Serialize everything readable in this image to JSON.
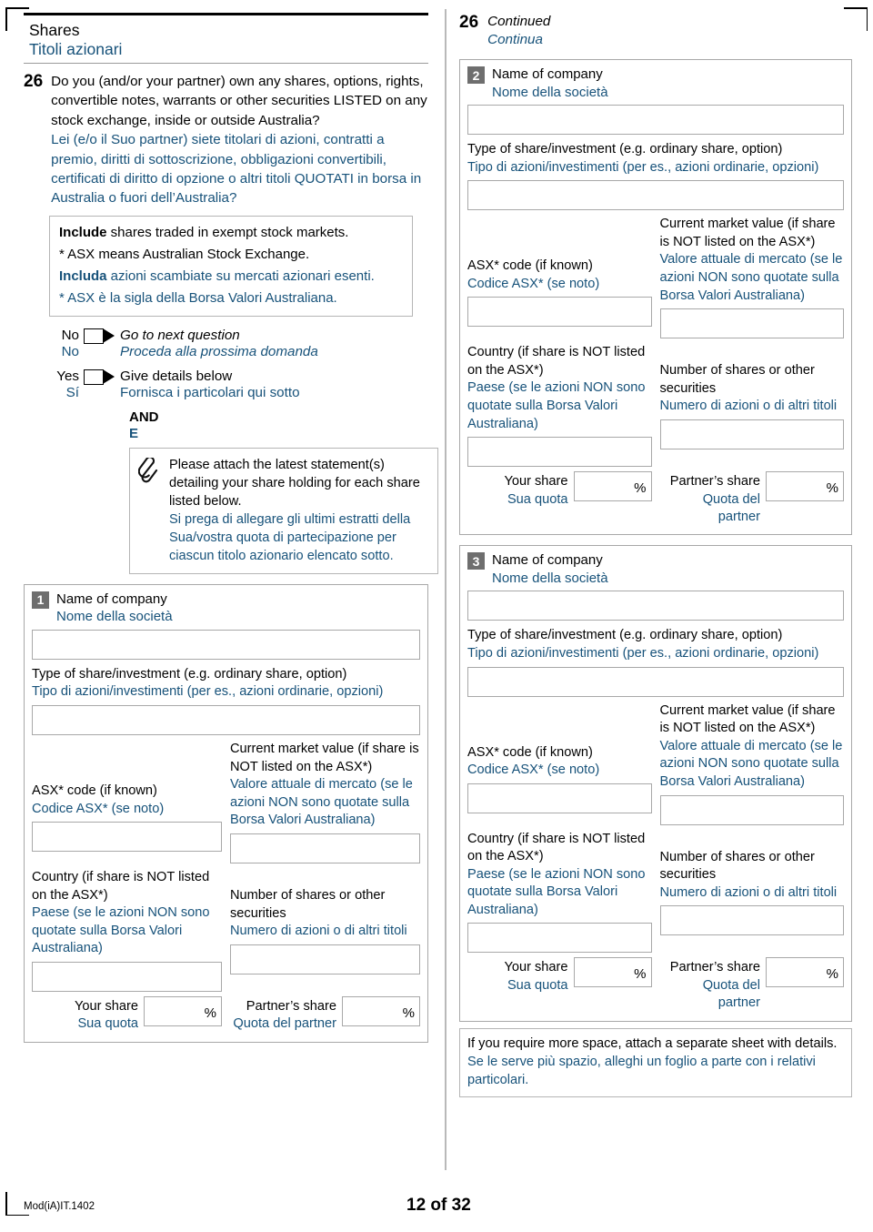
{
  "section": {
    "title_en": "Shares",
    "title_it": "Titoli azionari"
  },
  "question": {
    "number": "26",
    "text_en": "Do you (and/or your partner) own any shares, options, rights, convertible notes, warrants or other securities LISTED on any stock exchange, inside or outside Australia?",
    "text_it": "Lei (e/o il Suo partner) siete titolari di azioni, contratti a premio, diritti di sottoscrizione, obbligazioni convertibili, certificati di diritto di opzione o altri titoli QUOTATI in borsa in Australia o fuori dell’Australia?"
  },
  "note": {
    "line1_bold": "Include",
    "line1_rest": " shares traded in exempt stock markets.",
    "line2": "* ASX means Australian Stock Exchange.",
    "line3_bold": "Includa",
    "line3_rest": " azioni scambiate su mercati azionari esenti.",
    "line4": "* ASX è la sigla della Borsa Valori Australiana."
  },
  "answers": {
    "no": {
      "label_en": "No",
      "label_it": "No",
      "action_en": "Go to next question",
      "action_it": "Proceda alla prossima domanda"
    },
    "yes": {
      "label_en": "Yes",
      "label_it": "Sí",
      "action_en": "Give details below",
      "action_it": "Fornisca i particolari qui sotto"
    },
    "and_en": "AND",
    "and_it": "E"
  },
  "attachment": {
    "icon": "paperclip-icon",
    "text_en": "Please attach the latest statement(s) detailing your share holding for each share listed below.",
    "text_it": "Si prega di allegare gli ultimi estratti della Sua/vostra quota di partecipazione per ciascun titolo azionario elencato sotto."
  },
  "continued": {
    "number": "26",
    "label_en": "Continued",
    "label_it": "Continua"
  },
  "field_labels": {
    "company_en": "Name of company",
    "company_it": "Nome della società",
    "type_en": "Type of share/investment (e.g. ordinary share, option)",
    "type_it": "Tipo di azioni/investimenti (per es., azioni ordinarie, opzioni)",
    "asx_en": "ASX* code (if known)",
    "asx_it": "Codice ASX* (se noto)",
    "market_en": "Current market value (if share is NOT listed on the ASX*)",
    "market_it": "Valore attuale di mercato (se le azioni NON sono quotate sulla Borsa Valori Australiana)",
    "country_en": "Country (if share is NOT listed on the ASX*)",
    "country_it": "Paese (se le azioni NON sono quotate sulla Borsa Valori Australiana)",
    "number_en": "Number of shares or other securities",
    "number_it": "Numero di azioni o di altri titoli",
    "your_share_en": "Your share",
    "your_share_it": "Sua quota",
    "partner_share_en": "Partner’s share",
    "partner_share_it": "Quota del partner",
    "percent": "%"
  },
  "entries": [
    {
      "badge": "1"
    },
    {
      "badge": "2"
    },
    {
      "badge": "3"
    }
  ],
  "more_space": {
    "text_en": "If you require more space, attach a separate sheet with details.",
    "text_it": "Se le serve più spazio, alleghi un foglio a parte con i relativi particolari."
  },
  "footer": {
    "form_code": "Mod(iA)IT.1402",
    "page": "12 of 32"
  },
  "colors": {
    "italian_text": "#17527a",
    "badge_bg": "#6e6e6e",
    "field_border": "#a8a8a8"
  }
}
